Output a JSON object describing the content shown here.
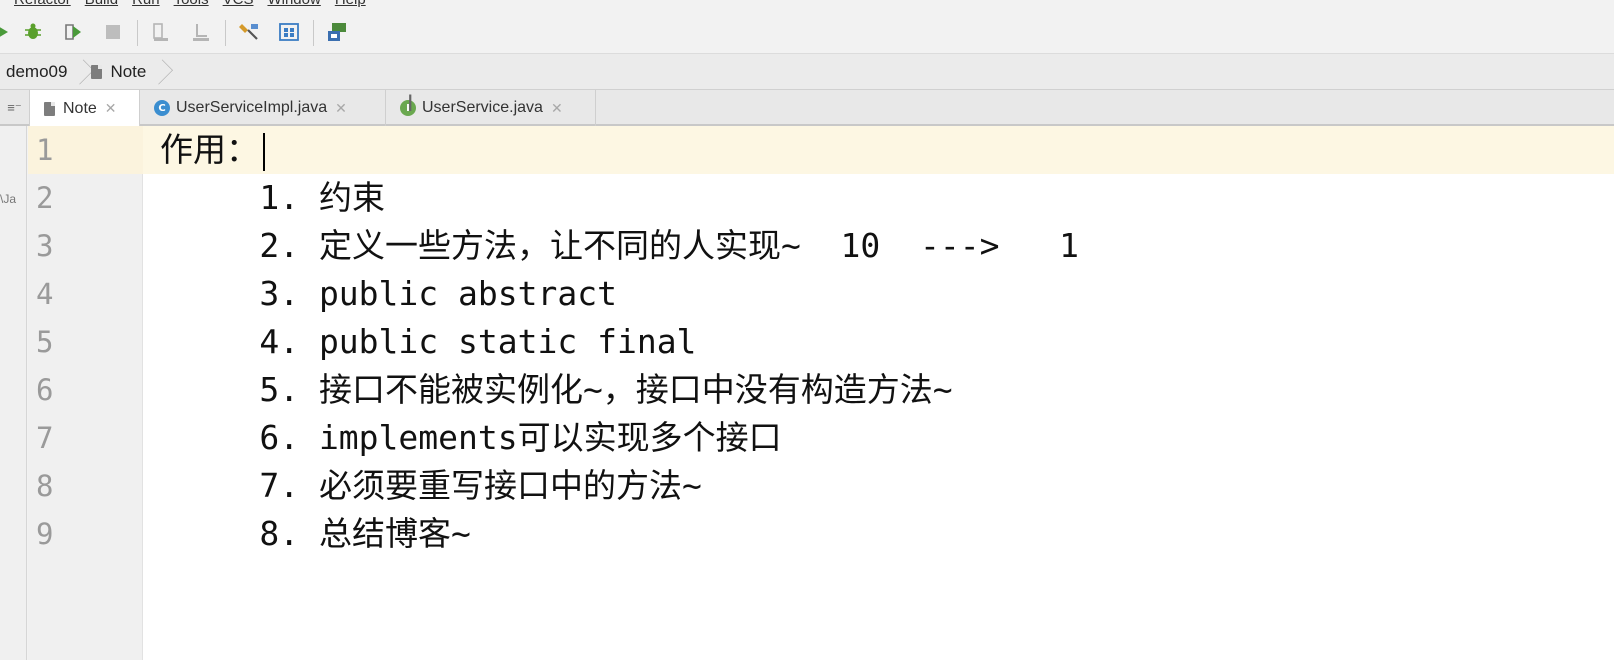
{
  "menu": {
    "items": [
      "Refactor",
      "Build",
      "Run",
      "Tools",
      "VCS",
      "Window",
      "Help"
    ]
  },
  "toolbar": {
    "icons": [
      "run-icon",
      "debug-icon",
      "run-coverage-icon",
      "stop-icon",
      "build-icon",
      "build-artifacts-icon",
      "project-structure-icon",
      "sdk-icon",
      "vcs-icon"
    ]
  },
  "breadcrumb": {
    "project": "demo09",
    "file": "Note"
  },
  "tabs": [
    {
      "label": "Note",
      "type": "text",
      "active": true
    },
    {
      "label": "UserServiceImpl.java",
      "type": "class",
      "badge": "C",
      "active": false
    },
    {
      "label": "UserService.java",
      "type": "interface",
      "badge": "I",
      "active": false
    }
  ],
  "editor": {
    "lines": [
      {
        "number": "1",
        "text": "作用："
      },
      {
        "number": "2",
        "text": "     1. 约束"
      },
      {
        "number": "3",
        "text": "     2. 定义一些方法，让不同的人实现~  10  --->   1"
      },
      {
        "number": "4",
        "text": "     3. public abstract"
      },
      {
        "number": "5",
        "text": "     4. public static final"
      },
      {
        "number": "6",
        "text": "     5. 接口不能被实例化~，接口中没有构造方法~"
      },
      {
        "number": "7",
        "text": "     6. implements可以实现多个接口"
      },
      {
        "number": "8",
        "text": "     7. 必须要重写接口中的方法~"
      },
      {
        "number": "9",
        "text": "     8. 总结博客~"
      }
    ]
  },
  "colors": {
    "current_line": "#fdf7e3",
    "gutter": "#f0f0f0",
    "class_badge": "#3b8ed0",
    "interface_badge": "#6aa84f"
  }
}
